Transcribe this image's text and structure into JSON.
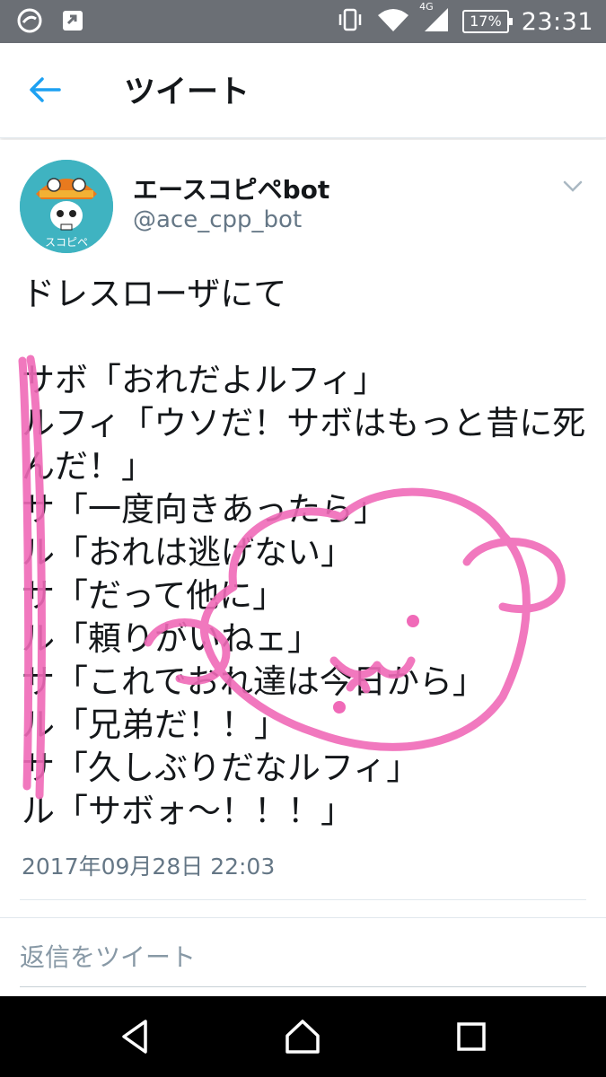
{
  "status_bar": {
    "time": "23:31",
    "battery": "17%",
    "network": "4G",
    "icons": [
      "app-notification-icon",
      "sim-transfer-icon",
      "vibrate-icon",
      "wifi-icon",
      "signal-icon",
      "battery-icon"
    ]
  },
  "app_bar": {
    "title": "ツイート",
    "back_icon": "arrow-left-icon"
  },
  "tweet": {
    "display_name": "エースコピペbot",
    "handle": "@ace_cpp_bot",
    "avatar_text": "スコピペ",
    "text": "ドレスローザにて\n\nサボ「おれだよルフィ」\nルフィ「ウソだ！サボはもっと昔に死んだ！」\nサ「一度向きあったら」\nル「おれは逃げない」\nサ「だって他に」\nル「頼りがいねェ」\nサ「これでおれ達は今日から」\nル「兄弟だ！！」\nサ「久しぶりだなルフィ」\nル「サボォ〜！！！」",
    "timestamp": "2017年09月28日 22:03"
  },
  "reply": {
    "placeholder": "返信をツイート"
  },
  "colors": {
    "status_bar": "#6b6f75",
    "accent": "#1da1f2",
    "scribble": "#f06ab8",
    "avatar_bg": "#3fb3c1"
  }
}
